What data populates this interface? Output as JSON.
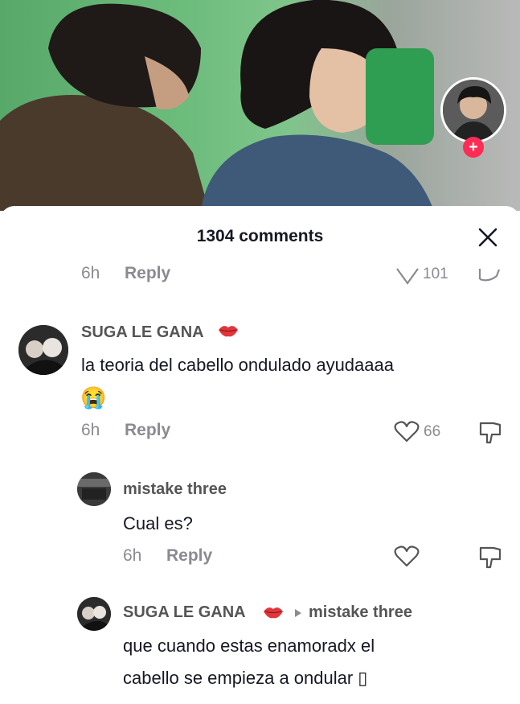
{
  "header": {
    "comment_count_label": "1304 comments"
  },
  "partial_comment": {
    "time": "6h",
    "reply_label": "Reply",
    "likes": "101"
  },
  "comments": [
    {
      "username": "SUGA LE GANA",
      "text": "la teoria del cabello ondulado ayudaaaa",
      "emoji": "😭",
      "time": "6h",
      "reply_label": "Reply",
      "likes": "66"
    },
    {
      "username": "mistake three",
      "text": "Cual es?",
      "time": "6h",
      "reply_label": "Reply",
      "likes": ""
    },
    {
      "username": "SUGA LE GANA",
      "reply_to": "mistake three",
      "text_line1": "que cuando estas enamoradx el",
      "text_line2": "cabello se empieza a ondular ▯"
    }
  ],
  "icons": {
    "close": "close-icon",
    "like": "heart-outline-icon",
    "dislike": "thumbs-down-icon",
    "lips": "lips-icon",
    "plus": "plus-icon",
    "reply_arrow": "triangle-right-icon"
  },
  "colors": {
    "accent": "#fe2c55",
    "muted": "#8a8b91",
    "text": "#161823"
  }
}
